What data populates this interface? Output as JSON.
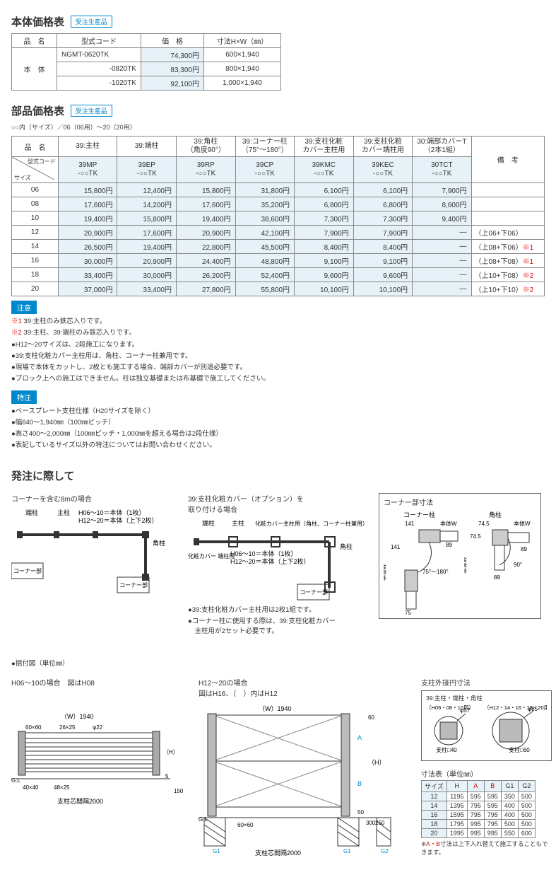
{
  "body_price": {
    "title": "本体価格表",
    "badge": "受注生産品",
    "headers": {
      "name": "品　名",
      "model": "型式コード",
      "price": "価　格",
      "dim": "寸法H×W（㎜）"
    },
    "name": "本　体",
    "rows": [
      {
        "model": "NGMT-0620TK",
        "price": "74,300円",
        "dim": "600×1,940"
      },
      {
        "model": "-0820TK",
        "price": "83,300円",
        "dim": "800×1,940"
      },
      {
        "model": "-1020TK",
        "price": "92,100円",
        "dim": "1,000×1,940"
      }
    ]
  },
  "parts_price": {
    "title": "部品価格表",
    "badge": "受注生産品",
    "subtext": "○○内（サイズ）／06（06用）～20（20用）",
    "headers": {
      "name": "品　名",
      "c0": "39:主柱",
      "c1": "39:端柱",
      "c2": "39:角柱\n（角度90°）",
      "c3": "39:コーナー柱\n（75°～180°）",
      "c4": "39:支柱化粧\nカバー主柱用",
      "c5": "39:支柱化粧\nカバー端柱用",
      "c6": "30:端部カバーT\n（2本1組）",
      "remark": "備　考",
      "modelcode": "型式コード",
      "size": "サイズ"
    },
    "codes": [
      "39MP\n-○○TK",
      "39EP\n-○○TK",
      "39RP\n-○○TK",
      "39CP\n-○○TK",
      "39KMC\n-○○TK",
      "39KEC\n-○○TK",
      "30TCT\n-○○TK"
    ],
    "rows": [
      {
        "size": "06",
        "v": [
          "15,800円",
          "12,400円",
          "15,800円",
          "31,800円",
          "6,100円",
          "6,100円",
          "7,900円"
        ],
        "rem": ""
      },
      {
        "size": "08",
        "v": [
          "17,600円",
          "14,200円",
          "17,600円",
          "35,200円",
          "6,800円",
          "6,800円",
          "8,600円"
        ],
        "rem": ""
      },
      {
        "size": "10",
        "v": [
          "19,400円",
          "15,800円",
          "19,400円",
          "38,600円",
          "7,300円",
          "7,300円",
          "9,400円"
        ],
        "rem": ""
      },
      {
        "size": "12",
        "v": [
          "20,900円",
          "17,600円",
          "20,900円",
          "42,100円",
          "7,900円",
          "7,900円",
          "—"
        ],
        "rem": "（上06+下06）"
      },
      {
        "size": "14",
        "v": [
          "26,500円",
          "19,400円",
          "22,800円",
          "45,500円",
          "8,400円",
          "8,400円",
          "—"
        ],
        "rem": "（上08+下06）※1"
      },
      {
        "size": "16",
        "v": [
          "30,000円",
          "20,900円",
          "24,400円",
          "48,800円",
          "9,100円",
          "9,100円",
          "—"
        ],
        "rem": "（上08+下08）※1"
      },
      {
        "size": "18",
        "v": [
          "33,400円",
          "30,000円",
          "26,200円",
          "52,400円",
          "9,600円",
          "9,600円",
          "—"
        ],
        "rem": "（上10+下08）※2"
      },
      {
        "size": "20",
        "v": [
          "37,000円",
          "33,400円",
          "27,800円",
          "55,800円",
          "10,100円",
          "10,100円",
          "—"
        ],
        "rem": "（上10+下10）※2"
      }
    ]
  },
  "notes": {
    "caution_tag": "注意",
    "caution": [
      "※1 39:主柱のみ鉄芯入りです。",
      "※2 39:主柱、39:端柱のみ鉄芯入りです。",
      "●H12～20サイズは、2段施工になります。",
      "●39:支柱化粧カバー主柱用は、角柱、コーナー柱兼用です。",
      "●現場で本体をカットし、2枚とも施工する場合、端部カバーが別途必要です。",
      "●ブロック上への施工はできません。柱は独立基礎または布基礎で施工してください。"
    ],
    "special_tag": "特注",
    "special": [
      "●ベースプレート支柱仕様（H20サイズを除く）",
      "●幅640～1,940㎜（100㎜ピッチ）",
      "●高さ400～2,000㎜（100㎜ピッチ・1,000㎜を超える場合は2段仕様）",
      "●表記しているサイズ以外の特注についてはお問い合わせください。"
    ]
  },
  "ordering": {
    "title": "発注に際して",
    "left_title": "コーナーを含む8mの場合",
    "left_labels": {
      "end": "端柱",
      "main": "主柱",
      "body1": "H06～10＝本体（1枚）",
      "body2": "H12～20＝本体（上下2枚）",
      "corner": "角柱",
      "cornerp": "コーナー部"
    },
    "mid_title": "39:支柱化粧カバー（オプション）を\n取り付ける場合",
    "mid_labels": {
      "end": "端柱",
      "main": "主柱",
      "cover_main": "化粧カバー主柱用（角柱、コーナー柱兼用）",
      "cover_end": "化粧カバー\n端柱用",
      "body1": "H06～10＝本体（1枚）",
      "body2": "H12～20＝本体（上下2枚）",
      "corner": "角柱",
      "cornerp": "コーナー部"
    },
    "mid_notes": [
      "●39:支柱化粧カバー主柱用は2枚1組です。",
      "●コーナー柱に使用する際は、39:支柱化粧カバー\n　主柱用が2セット必要です。"
    ],
    "right_title": "コーナー部寸法",
    "right_labels": {
      "cornerp": "コーナー柱",
      "kaku": "角柱",
      "d141": "141",
      "d745": "74.5",
      "d89": "89",
      "d75": "75",
      "bodyw": "本体W",
      "angle": "75°～180°",
      "angle90": "90°"
    }
  },
  "install": {
    "left_title": "●据付図（単位㎜）",
    "left_sub": "H06～10の場合　図はH08",
    "mid_title": "H12～20の場合",
    "mid_sub": "図はH16、（　）内はH12",
    "labels": {
      "w1940": "（W）1940",
      "l6060": "60×60",
      "l2625": "26×25",
      "phi22": "φ22",
      "l4040": "40×40",
      "l4825": "48×25",
      "pitch": "支柱芯間隔2000",
      "gl": "G.L",
      "h": "（H）",
      "d150": "150",
      "d5": "5",
      "d60": "60",
      "d50": "50",
      "d300": "300",
      "d250": "250",
      "a": "A",
      "b": "B",
      "g1": "G1",
      "g2": "G2"
    },
    "right_title": "支柱外接円寸法",
    "right_sub": "39:主柱・端柱・角柱",
    "right_sizes1": "（H06・08・10用）",
    "right_sizes2": "（H12・14・16・18・20用）",
    "right_labels": {
      "phi57": "φ57",
      "phi85": "φ85",
      "sq40": "支柱□40",
      "sq60": "支柱□60"
    },
    "dim_title": "寸法表（単位㎜）",
    "dim_headers": [
      "サイズ",
      "H",
      "A",
      "B",
      "G1",
      "G2"
    ],
    "dim_rows": [
      [
        "12",
        "1195",
        "595",
        "595",
        "350",
        "500"
      ],
      [
        "14",
        "1395",
        "795",
        "595",
        "400",
        "500"
      ],
      [
        "16",
        "1595",
        "795",
        "795",
        "400",
        "500"
      ],
      [
        "18",
        "1795",
        "995",
        "795",
        "500",
        "500"
      ],
      [
        "20",
        "1995",
        "995",
        "995",
        "550",
        "600"
      ]
    ],
    "dim_note": "※A・B寸法は上下入れ替えて施工することもできます。"
  }
}
